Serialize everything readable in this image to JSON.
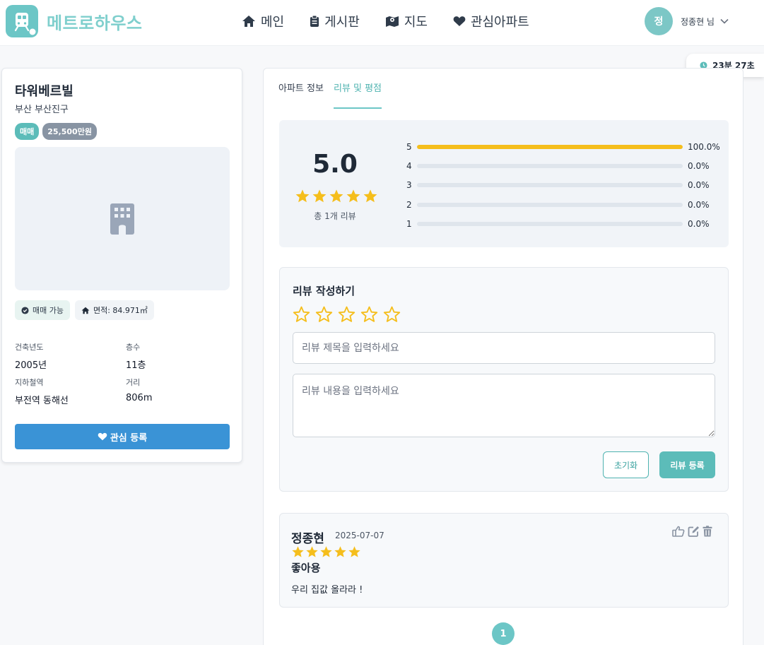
{
  "app": {
    "name": "메트로하우스"
  },
  "nav": [
    {
      "label": "메인",
      "icon": "home-icon"
    },
    {
      "label": "게시판",
      "icon": "clipboard-icon"
    },
    {
      "label": "지도",
      "icon": "map-icon"
    },
    {
      "label": "관심아파트",
      "icon": "heart-icon"
    }
  ],
  "user": {
    "initial": "정",
    "name": "정종현 님"
  },
  "timer": {
    "text": "23분 27초"
  },
  "apartment": {
    "name": "타워베르빌",
    "address": "부산 부산진구",
    "deal_type": "매매",
    "price": "25,500만원",
    "status_chip": "매매 가능",
    "area_chip": "면적: 84.971㎡",
    "info": [
      {
        "label": "건축년도",
        "value": "2005년"
      },
      {
        "label": "층수",
        "value": "11층"
      },
      {
        "label": "지하철역",
        "value": "부전역 동해선"
      },
      {
        "label": "거리",
        "value": "806m"
      }
    ],
    "favorite_button": "관심 등록"
  },
  "tabs": [
    {
      "label": "아파트 정보",
      "active": false
    },
    {
      "label": "리뷰 및 평점",
      "active": true
    }
  ],
  "rating": {
    "average": "5.0",
    "stars": 5,
    "total": "총 1개 리뷰",
    "distribution": [
      {
        "score": "5",
        "fraction": 1.0,
        "pct": "100.0%"
      },
      {
        "score": "4",
        "fraction": 0.0,
        "pct": "0.0%"
      },
      {
        "score": "3",
        "fraction": 0.0,
        "pct": "0.0%"
      },
      {
        "score": "2",
        "fraction": 0.0,
        "pct": "0.0%"
      },
      {
        "score": "1",
        "fraction": 0.0,
        "pct": "0.0%"
      }
    ]
  },
  "review_form": {
    "title": "리뷰 작성하기",
    "title_placeholder": "리뷰 제목을 입력하세요",
    "body_placeholder": "리뷰 내용을 입력하세요",
    "reset_label": "초기화",
    "submit_label": "리뷰 등록"
  },
  "reviews": [
    {
      "author": "정종현",
      "date": "2025-07-07",
      "stars": 5,
      "title": "좋아용",
      "body": "우리 집값 올라라 !"
    }
  ],
  "pagination": {
    "current": "1"
  },
  "colors": {
    "accent": "#6cc6c6",
    "star": "#f5be1c",
    "primary_button": "#3a93d6"
  }
}
